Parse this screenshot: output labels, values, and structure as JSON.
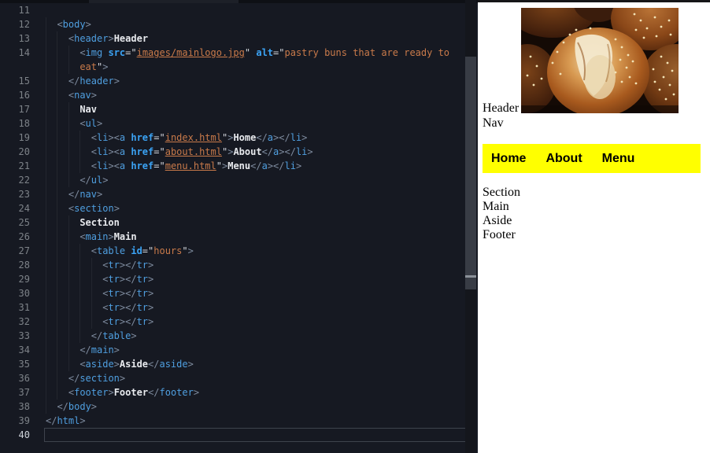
{
  "colors": {
    "editor_bg": "#161922",
    "nav_bg": "#ffff00",
    "tag": "#4f9fe0",
    "attr": "#3ba3f5",
    "string": "#c97a4a",
    "punct": "#7e8b9e",
    "quote": "#d4d8de",
    "text": "#e8eaee",
    "line_number": "#7d8288"
  },
  "editor": {
    "lines": [
      {
        "n": "11",
        "ind": 0,
        "seg": []
      },
      {
        "n": "12",
        "ind": 1,
        "seg": [
          [
            "a",
            "<"
          ],
          [
            "t",
            "body"
          ],
          [
            "a",
            ">"
          ]
        ]
      },
      {
        "n": "13",
        "ind": 2,
        "seg": [
          [
            "a",
            "<"
          ],
          [
            "t",
            "header"
          ],
          [
            "a",
            ">"
          ],
          [
            "x",
            "Header"
          ]
        ]
      },
      {
        "n": "14",
        "ind": 3,
        "seg": [
          [
            "a",
            "<"
          ],
          [
            "t",
            "img"
          ],
          [
            "w",
            " "
          ],
          [
            "at",
            "src"
          ],
          [
            "q",
            "=\""
          ],
          [
            "sl",
            "images/mainlogo.jpg"
          ],
          [
            "q",
            "\""
          ],
          [
            "w",
            " "
          ],
          [
            "at",
            "alt"
          ],
          [
            "q",
            "=\""
          ],
          [
            "s",
            "pastry buns that are ready to"
          ]
        ]
      },
      {
        "n": "",
        "ind": 3,
        "seg": [
          [
            "s",
            "eat"
          ],
          [
            "q",
            "\""
          ],
          [
            "a",
            ">"
          ]
        ]
      },
      {
        "n": "15",
        "ind": 2,
        "seg": [
          [
            "a",
            "</"
          ],
          [
            "t",
            "header"
          ],
          [
            "a",
            ">"
          ]
        ]
      },
      {
        "n": "16",
        "ind": 2,
        "seg": [
          [
            "a",
            "<"
          ],
          [
            "t",
            "nav"
          ],
          [
            "a",
            ">"
          ]
        ]
      },
      {
        "n": "17",
        "ind": 3,
        "seg": [
          [
            "x",
            "Nav"
          ]
        ]
      },
      {
        "n": "18",
        "ind": 3,
        "seg": [
          [
            "a",
            "<"
          ],
          [
            "t",
            "ul"
          ],
          [
            "a",
            ">"
          ]
        ]
      },
      {
        "n": "19",
        "ind": 4,
        "seg": [
          [
            "a",
            "<"
          ],
          [
            "t",
            "li"
          ],
          [
            "a",
            "><"
          ],
          [
            "t",
            "a"
          ],
          [
            "w",
            " "
          ],
          [
            "at",
            "href"
          ],
          [
            "q",
            "=\""
          ],
          [
            "sl",
            "index.html"
          ],
          [
            "q",
            "\""
          ],
          [
            "a",
            ">"
          ],
          [
            "x",
            "Home"
          ],
          [
            "a",
            "</"
          ],
          [
            "t",
            "a"
          ],
          [
            "a",
            "></"
          ],
          [
            "t",
            "li"
          ],
          [
            "a",
            ">"
          ]
        ]
      },
      {
        "n": "20",
        "ind": 4,
        "seg": [
          [
            "a",
            "<"
          ],
          [
            "t",
            "li"
          ],
          [
            "a",
            "><"
          ],
          [
            "t",
            "a"
          ],
          [
            "w",
            " "
          ],
          [
            "at",
            "href"
          ],
          [
            "q",
            "=\""
          ],
          [
            "sl",
            "about.html"
          ],
          [
            "q",
            "\""
          ],
          [
            "a",
            ">"
          ],
          [
            "x",
            "About"
          ],
          [
            "a",
            "</"
          ],
          [
            "t",
            "a"
          ],
          [
            "a",
            "></"
          ],
          [
            "t",
            "li"
          ],
          [
            "a",
            ">"
          ]
        ]
      },
      {
        "n": "21",
        "ind": 4,
        "seg": [
          [
            "a",
            "<"
          ],
          [
            "t",
            "li"
          ],
          [
            "a",
            "><"
          ],
          [
            "t",
            "a"
          ],
          [
            "w",
            " "
          ],
          [
            "at",
            "href"
          ],
          [
            "q",
            "=\""
          ],
          [
            "sl",
            "menu.html"
          ],
          [
            "q",
            "\""
          ],
          [
            "a",
            ">"
          ],
          [
            "x",
            "Menu"
          ],
          [
            "a",
            "</"
          ],
          [
            "t",
            "a"
          ],
          [
            "a",
            "></"
          ],
          [
            "t",
            "li"
          ],
          [
            "a",
            ">"
          ]
        ]
      },
      {
        "n": "22",
        "ind": 3,
        "seg": [
          [
            "a",
            "</"
          ],
          [
            "t",
            "ul"
          ],
          [
            "a",
            ">"
          ]
        ]
      },
      {
        "n": "23",
        "ind": 2,
        "seg": [
          [
            "a",
            "</"
          ],
          [
            "t",
            "nav"
          ],
          [
            "a",
            ">"
          ]
        ]
      },
      {
        "n": "24",
        "ind": 2,
        "seg": [
          [
            "a",
            "<"
          ],
          [
            "t",
            "section"
          ],
          [
            "a",
            ">"
          ]
        ]
      },
      {
        "n": "25",
        "ind": 3,
        "seg": [
          [
            "x",
            "Section"
          ]
        ]
      },
      {
        "n": "26",
        "ind": 3,
        "seg": [
          [
            "a",
            "<"
          ],
          [
            "t",
            "main"
          ],
          [
            "a",
            ">"
          ],
          [
            "x",
            "Main"
          ]
        ]
      },
      {
        "n": "27",
        "ind": 4,
        "seg": [
          [
            "a",
            "<"
          ],
          [
            "t",
            "table"
          ],
          [
            "w",
            " "
          ],
          [
            "at",
            "id"
          ],
          [
            "q",
            "=\""
          ],
          [
            "s",
            "hours"
          ],
          [
            "q",
            "\""
          ],
          [
            "a",
            ">"
          ]
        ]
      },
      {
        "n": "28",
        "ind": 5,
        "seg": [
          [
            "a",
            "<"
          ],
          [
            "t",
            "tr"
          ],
          [
            "a",
            "></"
          ],
          [
            "t",
            "tr"
          ],
          [
            "a",
            ">"
          ]
        ]
      },
      {
        "n": "29",
        "ind": 5,
        "seg": [
          [
            "a",
            "<"
          ],
          [
            "t",
            "tr"
          ],
          [
            "a",
            "></"
          ],
          [
            "t",
            "tr"
          ],
          [
            "a",
            ">"
          ]
        ]
      },
      {
        "n": "30",
        "ind": 5,
        "seg": [
          [
            "a",
            "<"
          ],
          [
            "t",
            "tr"
          ],
          [
            "a",
            "></"
          ],
          [
            "t",
            "tr"
          ],
          [
            "a",
            ">"
          ]
        ]
      },
      {
        "n": "31",
        "ind": 5,
        "seg": [
          [
            "a",
            "<"
          ],
          [
            "t",
            "tr"
          ],
          [
            "a",
            "></"
          ],
          [
            "t",
            "tr"
          ],
          [
            "a",
            ">"
          ]
        ]
      },
      {
        "n": "32",
        "ind": 5,
        "seg": [
          [
            "a",
            "<"
          ],
          [
            "t",
            "tr"
          ],
          [
            "a",
            "></"
          ],
          [
            "t",
            "tr"
          ],
          [
            "a",
            ">"
          ]
        ]
      },
      {
        "n": "33",
        "ind": 4,
        "seg": [
          [
            "a",
            "</"
          ],
          [
            "t",
            "table"
          ],
          [
            "a",
            ">"
          ]
        ]
      },
      {
        "n": "34",
        "ind": 3,
        "seg": [
          [
            "a",
            "</"
          ],
          [
            "t",
            "main"
          ],
          [
            "a",
            ">"
          ]
        ]
      },
      {
        "n": "35",
        "ind": 3,
        "seg": [
          [
            "a",
            "<"
          ],
          [
            "t",
            "aside"
          ],
          [
            "a",
            ">"
          ],
          [
            "x",
            "Aside"
          ],
          [
            "a",
            "</"
          ],
          [
            "t",
            "aside"
          ],
          [
            "a",
            ">"
          ]
        ]
      },
      {
        "n": "36",
        "ind": 2,
        "seg": [
          [
            "a",
            "</"
          ],
          [
            "t",
            "section"
          ],
          [
            "a",
            ">"
          ]
        ]
      },
      {
        "n": "37",
        "ind": 2,
        "seg": [
          [
            "a",
            "<"
          ],
          [
            "t",
            "footer"
          ],
          [
            "a",
            ">"
          ],
          [
            "x",
            "Footer"
          ],
          [
            "a",
            "</"
          ],
          [
            "t",
            "footer"
          ],
          [
            "a",
            ">"
          ]
        ]
      },
      {
        "n": "38",
        "ind": 1,
        "seg": [
          [
            "a",
            "</"
          ],
          [
            "t",
            "body"
          ],
          [
            "a",
            ">"
          ]
        ]
      },
      {
        "n": "39",
        "ind": 0,
        "seg": [
          [
            "a",
            "</"
          ],
          [
            "t",
            "html"
          ],
          [
            "a",
            ">"
          ]
        ]
      },
      {
        "n": "40",
        "ind": 0,
        "seg": [],
        "cur": true
      }
    ]
  },
  "preview": {
    "header_label": "Header",
    "nav_label": "Nav",
    "nav_links": [
      "Home",
      "About",
      "Menu"
    ],
    "body_labels": [
      "Section",
      "Main",
      "Aside",
      "Footer"
    ]
  }
}
